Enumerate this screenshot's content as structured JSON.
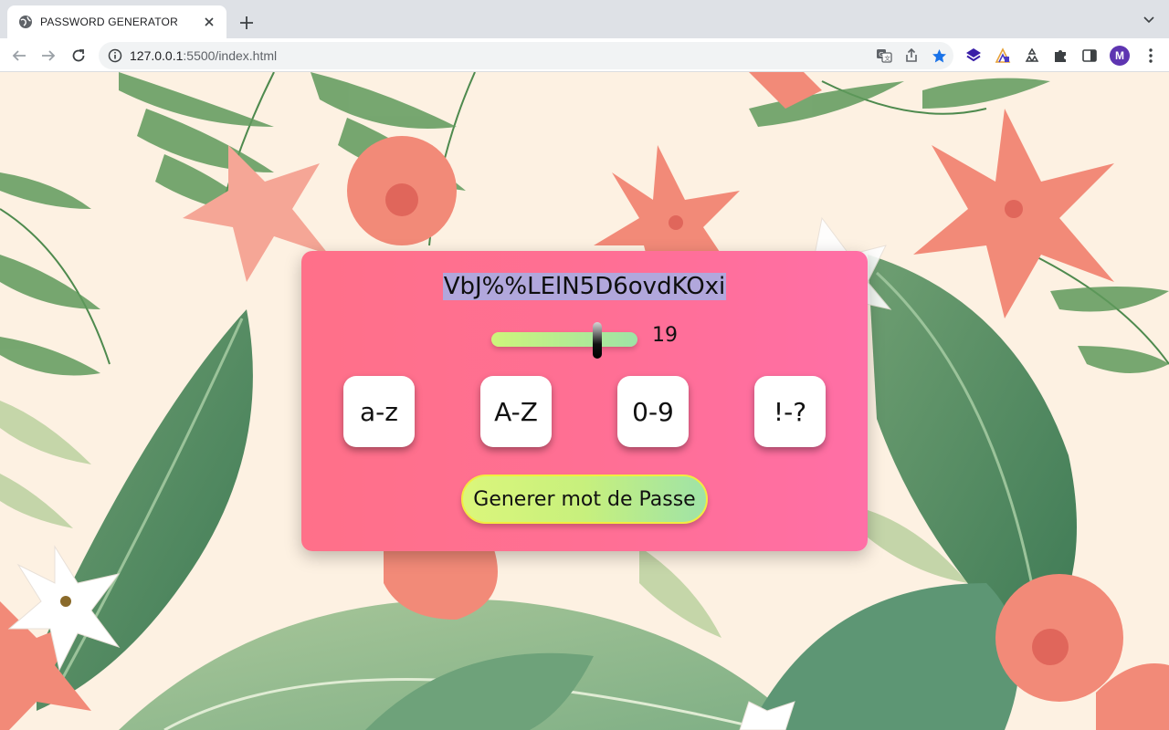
{
  "browser": {
    "tab": {
      "title": "PASSWORD GENERATOR",
      "favicon": "globe-icon",
      "close_icon": "close-icon"
    },
    "new_tab_icon": "plus-icon",
    "tab_menu_icon": "chevron-down-icon",
    "nav": {
      "back_icon": "arrow-left-icon",
      "forward_icon": "arrow-right-icon",
      "reload_icon": "reload-icon"
    },
    "omnibox": {
      "url_host": "127.0.0.1",
      "url_path": ":5500/index.html",
      "icons": [
        "info-icon",
        "translate-icon",
        "share-icon",
        "star-icon"
      ]
    },
    "extensions": [
      "stack-extension-icon",
      "chart-extension-icon",
      "recycle-extension-icon",
      "puzzle-icon",
      "side-panel-icon"
    ],
    "profile_initial": "M",
    "menu_icon": "kebab-menu-icon",
    "accent_color": "#1a73e8",
    "profile_color": "#5e35b1"
  },
  "app": {
    "password": "VbJ%%LElN5D6ovdKOxi",
    "length": {
      "value": 19,
      "fraction": 0.74
    },
    "options": [
      "a-z",
      "A-Z",
      "0-9",
      "!-?"
    ],
    "generate_label": "Generer mot de Passe",
    "colors": {
      "card": "#ff7092",
      "selection": "#b1a7dc",
      "button_from": "#dbf67b",
      "button_to": "#9fe3a7",
      "button_border": "#f3ec3f"
    }
  }
}
